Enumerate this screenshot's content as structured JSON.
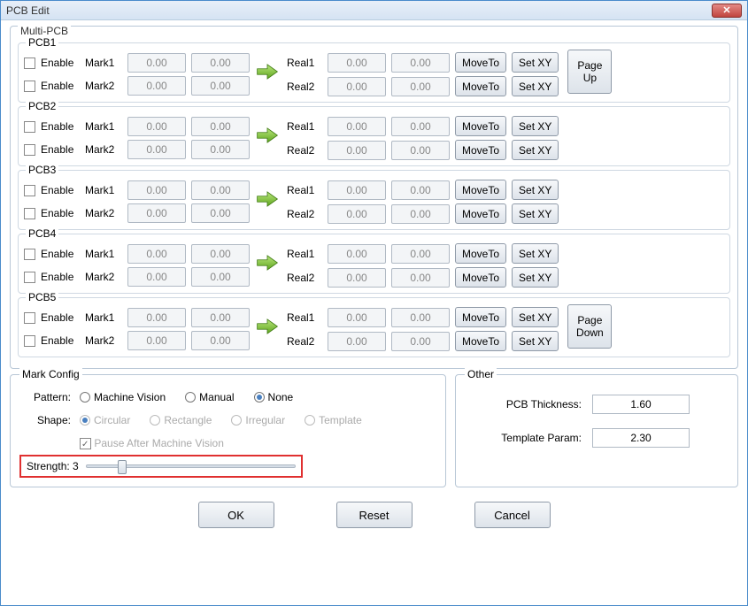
{
  "window": {
    "title": "PCB Edit"
  },
  "multi_pcb": {
    "group_label": "Multi-PCB",
    "enable_label": "Enable",
    "mark1_label": "Mark1",
    "mark2_label": "Mark2",
    "real1_label": "Real1",
    "real2_label": "Real2",
    "moveto_label": "MoveTo",
    "setxy_label": "Set XY",
    "page_up_label": "Page Up",
    "page_down_label": "Page Down",
    "pcbs": [
      {
        "name": "PCB1",
        "m1x": "0.00",
        "m1y": "0.00",
        "r1x": "0.00",
        "r1y": "0.00",
        "m2x": "0.00",
        "m2y": "0.00",
        "r2x": "0.00",
        "r2y": "0.00",
        "page_button": "up"
      },
      {
        "name": "PCB2",
        "m1x": "0.00",
        "m1y": "0.00",
        "r1x": "0.00",
        "r1y": "0.00",
        "m2x": "0.00",
        "m2y": "0.00",
        "r2x": "0.00",
        "r2y": "0.00"
      },
      {
        "name": "PCB3",
        "m1x": "0.00",
        "m1y": "0.00",
        "r1x": "0.00",
        "r1y": "0.00",
        "m2x": "0.00",
        "m2y": "0.00",
        "r2x": "0.00",
        "r2y": "0.00"
      },
      {
        "name": "PCB4",
        "m1x": "0.00",
        "m1y": "0.00",
        "r1x": "0.00",
        "r1y": "0.00",
        "m2x": "0.00",
        "m2y": "0.00",
        "r2x": "0.00",
        "r2y": "0.00"
      },
      {
        "name": "PCB5",
        "m1x": "0.00",
        "m1y": "0.00",
        "r1x": "0.00",
        "r1y": "0.00",
        "m2x": "0.00",
        "m2y": "0.00",
        "r2x": "0.00",
        "r2y": "0.00",
        "page_button": "down"
      }
    ]
  },
  "mark_config": {
    "title": "Mark Config",
    "pattern_label": "Pattern:",
    "pattern_options": {
      "mv": "Machine Vision",
      "manual": "Manual",
      "none": "None"
    },
    "pattern_selected": "none",
    "shape_label": "Shape:",
    "shape_options": {
      "circular": "Circular",
      "rectangle": "Rectangle",
      "irregular": "Irregular",
      "template": "Template"
    },
    "pause_label": "Pause After Machine Vision",
    "pause_checked": true,
    "strength_label": "Strength: 3",
    "strength_value": 3,
    "strength_min": 0,
    "strength_max": 20
  },
  "other": {
    "title": "Other",
    "thickness_label": "PCB Thickness:",
    "thickness_value": "1.60",
    "template_label": "Template Param:",
    "template_value": "2.30"
  },
  "buttons": {
    "ok": "OK",
    "reset": "Reset",
    "cancel": "Cancel"
  }
}
